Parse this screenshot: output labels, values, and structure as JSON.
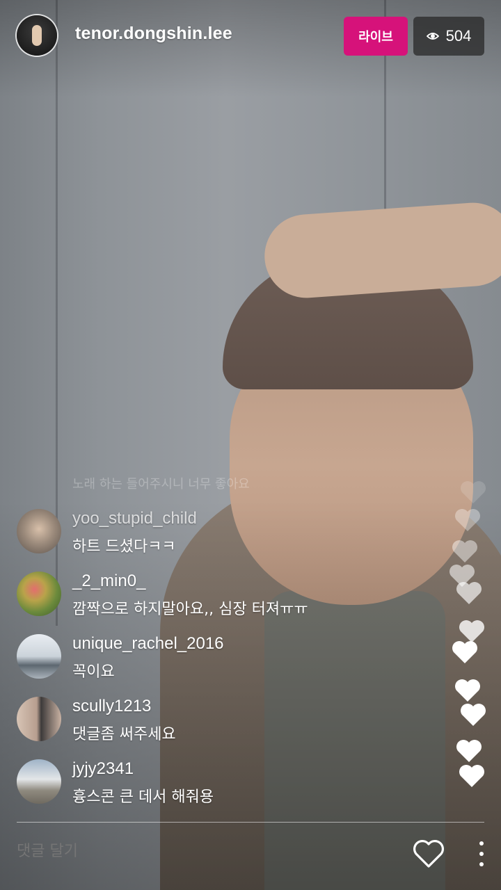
{
  "header": {
    "host_username": "tenor.dongshin.lee",
    "live_label": "라이브",
    "viewer_count": "504",
    "viewer_icon": "eye-icon"
  },
  "comments": {
    "faded_text": "노래 하는 들어주시니 너무 좋아요",
    "items": [
      {
        "username": "yoo_stupid_child",
        "text": "하트 드셨다ㅋㅋ"
      },
      {
        "username": "_2_min0_",
        "text": "깜짝으로 하지말아요,, 심장 터져ㅠㅠ"
      },
      {
        "username": "unique_rachel_2016",
        "text": "꼭이요"
      },
      {
        "username": "scully1213",
        "text": "댓글좀 써주세요"
      },
      {
        "username": "jyjy2341",
        "text": "흉스콘 큰 데서 해줘용"
      }
    ]
  },
  "footer": {
    "comment_placeholder": "댓글 달기",
    "like_icon": "heart-outline-icon",
    "more_icon": "more-vertical-icon"
  },
  "colors": {
    "live_badge": "#d6127a",
    "viewer_badge": "#282828"
  }
}
